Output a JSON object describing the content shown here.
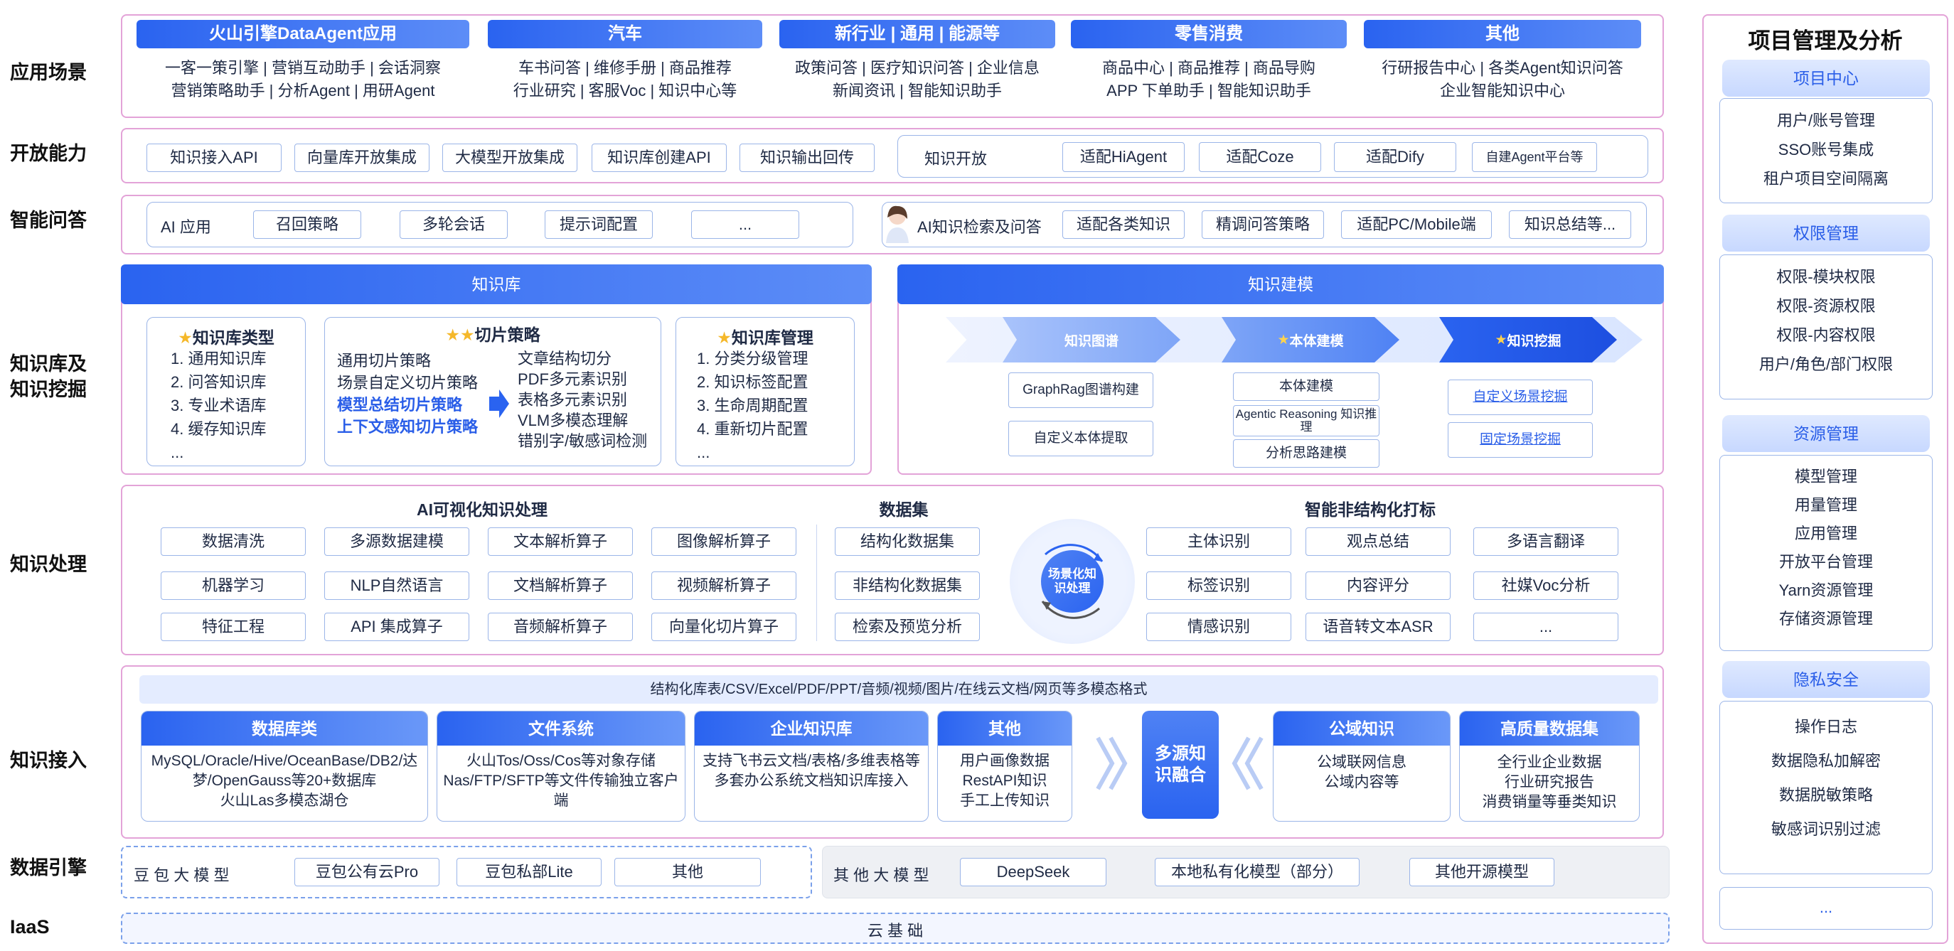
{
  "row_labels": {
    "scenario": "应用场景",
    "open": "开放能力",
    "qa": "智能问答",
    "kb": "知识库及\n知识挖掘",
    "process": "知识处理",
    "ingest": "知识接入",
    "engine": "数据引擎",
    "iaas": "IaaS"
  },
  "scenarios": [
    {
      "title": "火山引擎DataAgent应用",
      "line1": "一客一策引擎  |  营销互动助手  |  会话洞察",
      "line2": "营销策略助手  |  分析Agent  |  用研Agent"
    },
    {
      "title": "汽车",
      "line1": "车书问答  |  维修手册  |  商品推荐",
      "line2": "行业研究 | 客服Voc  | 知识中心等"
    },
    {
      "title": "新行业 | 通用 | 能源等",
      "line1": "政策问答 | 医疗知识问答 | 企业信息",
      "line2": "新闻资讯        |        智能知识助手"
    },
    {
      "title": "零售消费",
      "line1": "商品中心  |  商品推荐  |  商品导购",
      "line2": "APP   下单助手  |  智能知识助手"
    },
    {
      "title": "其他",
      "line1": "行研报告中心 | 各类Agent知识问答",
      "line2": "企业智能知识中心"
    }
  ],
  "open": {
    "items": [
      "知识接入API",
      "向量库开放集成",
      "大模型开放集成",
      "知识库创建API",
      "知识输出回传"
    ],
    "right_label": "知识开放",
    "right_items": [
      "适配HiAgent",
      "适配Coze",
      "适配Dify",
      "自建Agent平台等"
    ]
  },
  "qa": {
    "left_label": "AI 应用",
    "left_items": [
      "召回策略",
      "多轮会话",
      "提示词配置",
      "..."
    ],
    "right_label": "AI知识检索及问答",
    "right_items": [
      "适配各类知识",
      "精调问答策略",
      "适配PC/Mobile端",
      "知识总结等..."
    ]
  },
  "kb": {
    "title": "知识库",
    "types_title": "知识库类型",
    "types": [
      "1.   通用知识库",
      "2.   问答知识库",
      "3.   专业术语库",
      "4.   缓存知识库",
      "..."
    ],
    "slice_title": "切片策略",
    "slice_left": [
      "通用切片策略",
      "场景自定义切片策略",
      "模型总结切片策略",
      "上下文感知切片策略"
    ],
    "slice_right": [
      "文章结构切分",
      "PDF多元素识别",
      "表格多元素识别",
      "VLM多模态理解",
      "错别字/敏感词检测"
    ],
    "mgmt_title": "知识库管理",
    "mgmt": [
      "1.   分类分级管理",
      "2.   知识标签配置",
      "3.   生命周期配置",
      "4.   重新切片配置",
      "..."
    ]
  },
  "model": {
    "title": "知识建模",
    "stages": [
      "知识图谱",
      "本体建模",
      "知识挖掘"
    ],
    "col1": [
      "GraphRag图谱构建",
      "自定义本体提取"
    ],
    "col2": [
      "本体建模",
      "Agentic Reasoning 知识推理",
      "分析思路建模"
    ],
    "col3": [
      "自定义场景挖掘",
      "固定场景挖掘"
    ]
  },
  "process": {
    "ai_title": "AI可视化知识处理",
    "ai_items": [
      "数据清洗",
      "多源数据建模",
      "文本解析算子",
      "图像解析算子",
      "机器学习",
      "NLP自然语言",
      "文档解析算子",
      "视频解析算子",
      "特征工程",
      "API 集成算子",
      "音频解析算子",
      "向量化切片算子"
    ],
    "ds_title": "数据集",
    "ds_items": [
      "结构化数据集",
      "非结构化数据集",
      "检索及预览分析"
    ],
    "center": "场景化知识处理",
    "tag_title": "智能非结构化打标",
    "tag_items": [
      "主体识别",
      "观点总结",
      "多语言翻译",
      "标签识别",
      "内容评分",
      "社媒Voc分析",
      "情感识别",
      "语音转文本ASR",
      "..."
    ]
  },
  "ingest": {
    "formats": "结构化库表/CSV/Excel/PDF/PPT/音频/视频/图片/在线云文档/网页等多模态格式",
    "blocks": [
      {
        "title": "数据库类",
        "body": "MySQL/Oracle/Hive/OceanBase/DB2/达梦/OpenGauss等20+数据库\n火山Las多模态湖仓"
      },
      {
        "title": "文件系统",
        "body": "火山Tos/Oss/Cos等对象存储\nNas/FTP/SFTP等文件传输独立客户端"
      },
      {
        "title": "企业知识库",
        "body": "支持飞书云文档/表格/多维表格等多套办公系统文档知识库接入"
      },
      {
        "title": "其他",
        "body": "用户画像数据\nRestAPI知识\n手工上传知识"
      }
    ],
    "fusion": "多源知识融合",
    "right_blocks": [
      {
        "title": "公域知识",
        "body": "公域联网信息\n公域内容等"
      },
      {
        "title": "高质量数据集",
        "body": "全行业企业数据\n行业研究报告\n消费销量等垂类知识"
      }
    ]
  },
  "engine": {
    "left_label": "豆 包 大 模 型",
    "left_items": [
      "豆包公有云Pro",
      "豆包私部Lite",
      "其他"
    ],
    "right_label": "其 他 大 模 型",
    "right_items": [
      "DeepSeek",
      "本地私有化模型（部分）",
      "其他开源模型"
    ]
  },
  "iaas": {
    "label": "云 基 础"
  },
  "side": {
    "title": "项目管理及分析",
    "groups": [
      {
        "head": "项目中心",
        "items": [
          "用户/账号管理",
          "SSO账号集成",
          "租户项目空间隔离"
        ]
      },
      {
        "head": "权限管理",
        "items": [
          "权限-模块权限",
          "权限-资源权限",
          "权限-内容权限",
          "用户/角色/部门权限"
        ]
      },
      {
        "head": "资源管理",
        "items": [
          "模型管理",
          "用量管理",
          "应用管理",
          "开放平台管理",
          "Yarn资源管理",
          "存储资源管理"
        ]
      },
      {
        "head": "隐私安全",
        "items": [
          "操作日志",
          "数据隐私加解密",
          "数据脱敏策略",
          "敏感词识别过滤"
        ]
      }
    ],
    "more": "..."
  },
  "colors": {
    "accent": "#2a63f0",
    "frame": "#e3a3d8",
    "box_border": "#9bb5e8"
  }
}
